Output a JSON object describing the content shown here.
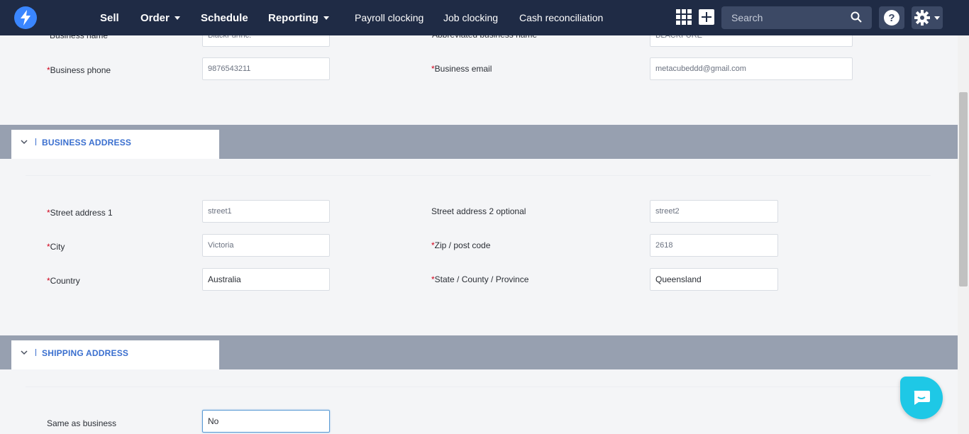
{
  "nav": {
    "items": [
      {
        "label": "Sell"
      },
      {
        "label": "Order"
      },
      {
        "label": "Schedule"
      },
      {
        "label": "Reporting"
      },
      {
        "label": "Payroll clocking"
      },
      {
        "label": "Job clocking"
      },
      {
        "label": "Cash reconciliation"
      }
    ],
    "search_placeholder": "Search",
    "icons": [
      "logo-bolt-icon",
      "apps-grid-icon",
      "add-icon",
      "search-icon",
      "help-icon",
      "gear-icon"
    ]
  },
  "business_info": {
    "business_name_label": "Business name",
    "business_name_value": "BlackFurInc.",
    "abbrev_label": "Abbreviated business name",
    "abbrev_value": "BLACKFURE",
    "phone_label": "Business phone",
    "phone_value": "9876543211",
    "email_label": "Business email",
    "email_value": "metacubeddd@gmail.com"
  },
  "business_address": {
    "title": "BUSINESS ADDRESS",
    "street1_label": "Street address 1",
    "street1_value": "street1",
    "street2_label": "Street address 2 optional",
    "street2_value": "street2",
    "city_label": "City",
    "city_value": "Victoria",
    "zip_label": "Zip / post code",
    "zip_value": "2618",
    "country_label": "Country",
    "country_value": "Australia",
    "state_label": "State / County / Province",
    "state_value": "Queensland"
  },
  "shipping_address": {
    "title": "SHIPPING ADDRESS",
    "same_label": "Same as business",
    "same_value": "No"
  },
  "required_marker": "*",
  "colors": {
    "nav_bg": "#1f2b45",
    "accent": "#3a6fcf",
    "required": "#d0021b",
    "section_band": "#97a0b0",
    "chat": "#1ec8e6"
  }
}
